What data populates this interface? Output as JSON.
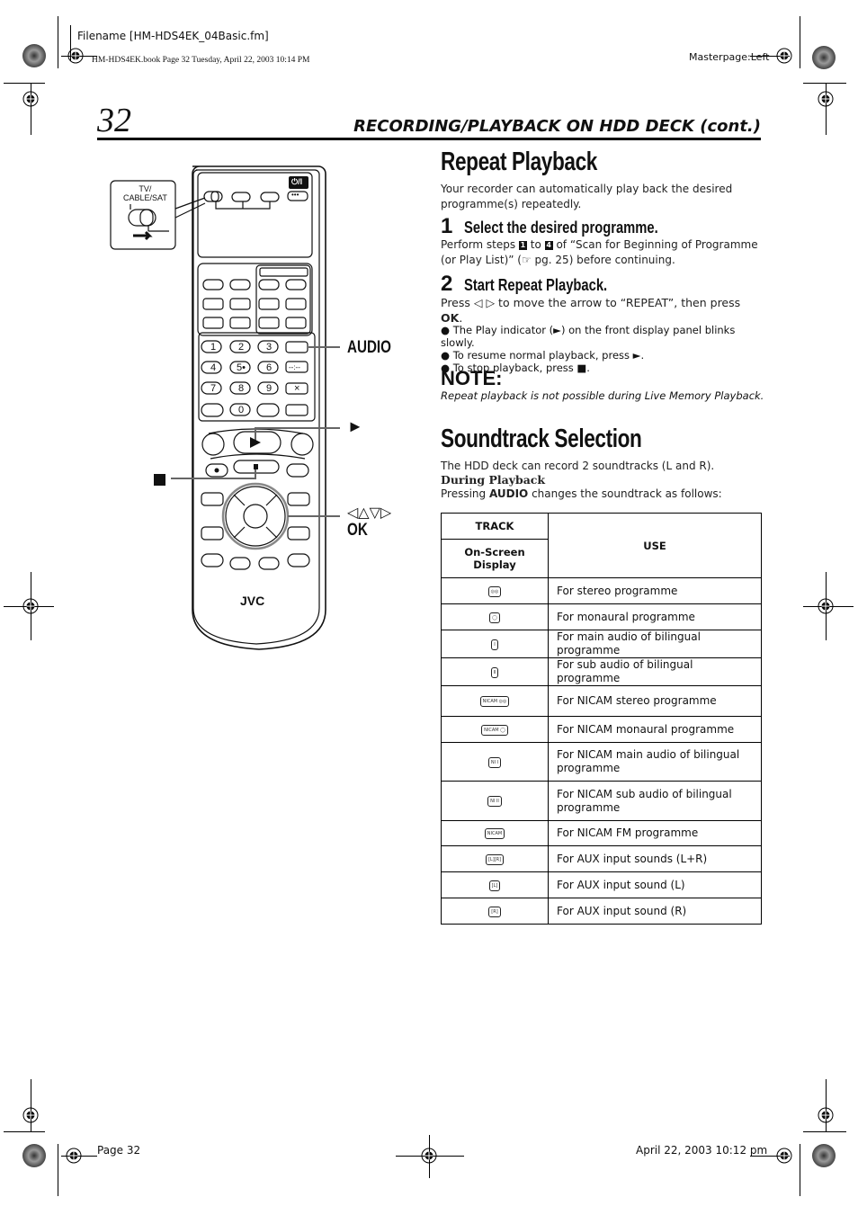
{
  "print_header": {
    "filename": "Filename [HM-HDS4EK_04Basic.fm]",
    "book_line": "HM-HDS4EK.book  Page 32  Tuesday, April 22, 2003  10:14 PM",
    "masterpage": "Masterpage:Left"
  },
  "page": {
    "number": "32",
    "section_title": "RECORDING/PLAYBACK ON HDD DECK (cont.)"
  },
  "remote": {
    "switch_label": "TV/\nCABLE/SAT",
    "power_label": "⏻/I",
    "dots_label": "•••",
    "keypad": [
      "1",
      "2",
      "3",
      "4",
      "5•",
      "6",
      "7",
      "8",
      "9",
      "0"
    ],
    "dash_label": "--:--",
    "x_label": "×",
    "brand": "JVC",
    "callouts": {
      "audio": "AUDIO",
      "play": "►",
      "stop": "■",
      "arrows": "◁△▽▷",
      "ok": "OK"
    }
  },
  "repeat_playback": {
    "title": "Repeat Playback",
    "intro": "Your recorder can automatically play back the desired programme(s) repeatedly.",
    "step1": {
      "num": "1",
      "title": "Select the desired programme.",
      "text_a": "Perform steps ",
      "box_a": "1",
      "text_b": " to ",
      "box_b": "4",
      "text_c": " of “Scan for Beginning of Programme (or Play List)” (☞ pg. 25) before continuing."
    },
    "step2": {
      "num": "2",
      "title": "Start Repeat Playback.",
      "text_a": "Press ◁ ▷ to move the arrow to “REPEAT”, then press ",
      "text_bold": "OK",
      "text_c": ".",
      "bullets": [
        "The Play indicator (►) on the front display panel blinks slowly.",
        "To resume normal playback, press ►.",
        "To stop playback, press ■."
      ]
    },
    "note": {
      "title": "NOTE:",
      "text": "Repeat playback is not possible during Live Memory Playback."
    }
  },
  "soundtrack": {
    "title": "Soundtrack Selection",
    "intro": "The HDD deck can record 2 soundtracks (L and R).",
    "subhead": "During Playback",
    "press_a": "Pressing ",
    "press_bold": "AUDIO",
    "press_c": " changes the soundtrack as follows:",
    "table": {
      "header_track": "TRACK",
      "header_osd": "On-Screen Display",
      "header_use": "USE",
      "rows": [
        {
          "icon": "stereo-icon",
          "osd": "◎◎",
          "use": "For stereo programme"
        },
        {
          "icon": "mono-icon",
          "osd": "◯",
          "use": "For monaural programme"
        },
        {
          "icon": "bilingual-main-icon",
          "osd": "I",
          "use": "For main audio of bilingual programme"
        },
        {
          "icon": "bilingual-sub-icon",
          "osd": "II",
          "use": "For sub audio of bilingual programme"
        },
        {
          "icon": "nicam-stereo-icon",
          "osd": "NICAM ◎◎",
          "use": "For NICAM stereo programme"
        },
        {
          "icon": "nicam-mono-icon",
          "osd": "NICAM ◯",
          "use": "For NICAM monaural programme"
        },
        {
          "icon": "nicam-main-icon",
          "osd": "NI I",
          "use": "For NICAM main audio of bilingual programme"
        },
        {
          "icon": "nicam-sub-icon",
          "osd": "NI II",
          "use": "For NICAM sub audio of bilingual programme"
        },
        {
          "icon": "nicam-fm-icon",
          "osd": "NICAM",
          "use": "For NICAM FM programme"
        },
        {
          "icon": "aux-lr-icon",
          "osd": "[L][R]",
          "use": "For AUX input sounds (L+R)"
        },
        {
          "icon": "aux-l-icon",
          "osd": "[L]",
          "use": "For AUX input sound (L)"
        },
        {
          "icon": "aux-r-icon",
          "osd": "[R]",
          "use": "For AUX input sound (R)"
        }
      ]
    }
  },
  "footer": {
    "page": "Page 32",
    "date": "April 22, 2003 10:12 pm"
  }
}
